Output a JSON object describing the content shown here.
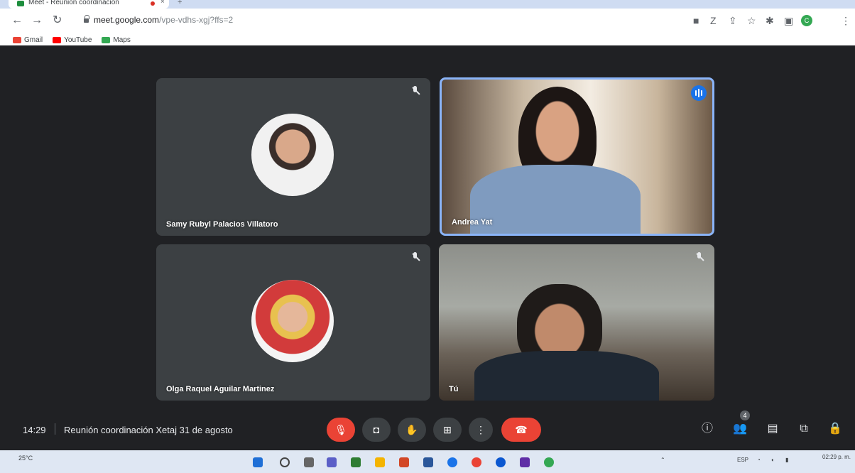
{
  "browser": {
    "tab_title": "Meet - Reunión coordinación",
    "tab_close": "×",
    "new_tab": "+",
    "url_host": "meet.google.com",
    "url_path": "/vpe-vdhs-xgj?ffs=2",
    "bookmarks": [
      {
        "label": "Gmail",
        "color": "#ea4335"
      },
      {
        "label": "YouTube",
        "color": "#ff0000"
      },
      {
        "label": "Maps",
        "color": "#34a853"
      }
    ],
    "profile_initial": "C"
  },
  "tiles": [
    {
      "name": "Samy Rubyl Palacios Villatoro"
    },
    {
      "name": "Andrea Yat"
    },
    {
      "name": "Olga Raquel Aguilar Martinez"
    },
    {
      "name": "Tú"
    }
  ],
  "bottom_bar": {
    "time": "14:29",
    "meeting_title": "Reunión coordinación Xetaj 31 de agosto",
    "participant_count": "4"
  },
  "taskbar": {
    "weather": "25°C",
    "language": "ESP",
    "time": "02:29 p. m."
  },
  "colors": {
    "meet_bg": "#202124",
    "tile_bg": "#3c4043",
    "accent": "#1a73e8",
    "danger": "#ea4335"
  }
}
